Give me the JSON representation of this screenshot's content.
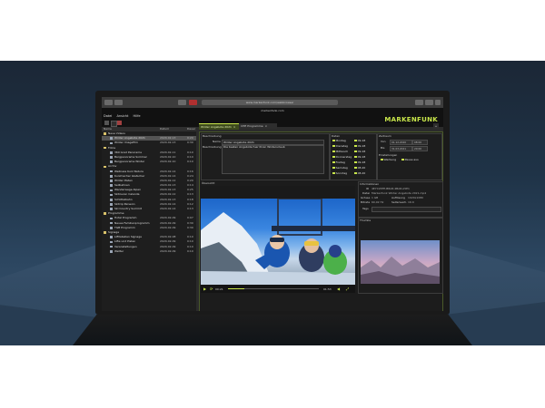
{
  "browser": {
    "url": "www.markenfunk.com/webbrowser",
    "app_title": "markenfunk.com"
  },
  "header": {
    "logo": "MARKENFUNK",
    "menu": [
      "Datei",
      "Ansicht",
      "Hilfe"
    ]
  },
  "tabs": [
    {
      "label": "Winter Angebote 2021",
      "active": true
    },
    {
      "label": "CHE Programme",
      "active": false
    }
  ],
  "sidebar": {
    "columns": [
      "Name",
      "Datum",
      "Dauer"
    ],
    "items": [
      {
        "name": "Neue Videos",
        "date": "",
        "time": "",
        "level": 0,
        "type": "folder",
        "selected": false
      },
      {
        "name": "Winter Angebote 2021",
        "date": "2020-02-13",
        "time": "0:20",
        "level": 1,
        "type": "video",
        "selected": true
      },
      {
        "name": "Winter Imagefilm",
        "date": "2020-02-13",
        "time": "0:30",
        "level": 1,
        "type": "video",
        "selected": false
      },
      {
        "name": "Fotos",
        "date": "",
        "time": "",
        "level": 0,
        "type": "folder",
        "selected": false
      },
      {
        "name": "360 Grad Panorama",
        "date": "2020-02-11",
        "time": "0:10",
        "level": 1,
        "type": "video",
        "selected": false
      },
      {
        "name": "Bergpanorama Sommer",
        "date": "2020-02-10",
        "time": "0:10",
        "level": 1,
        "type": "video",
        "selected": false
      },
      {
        "name": "Bergpanorama Winter",
        "date": "2020-02-10",
        "time": "0:10",
        "level": 1,
        "type": "video",
        "selected": false
      },
      {
        "name": "Archiv",
        "date": "",
        "time": "",
        "level": 0,
        "type": "folder",
        "selected": false
      },
      {
        "name": "Wellness Kurz Natura",
        "date": "2020-02-14",
        "time": "0:16",
        "level": 1,
        "type": "video",
        "selected": false
      },
      {
        "name": "Kurzmacher Gletscher",
        "date": "2020-02-14",
        "time": "0:24",
        "level": 1,
        "type": "video",
        "selected": false
      },
      {
        "name": "Winter Pisten",
        "date": "2020-02-12",
        "time": "0:20",
        "level": 1,
        "type": "video",
        "selected": false
      },
      {
        "name": "Seilbahnen",
        "date": "2020-02-13",
        "time": "0:14",
        "level": 1,
        "type": "video",
        "selected": false
      },
      {
        "name": "Wanderwege Alpen",
        "date": "2020-02-13",
        "time": "0:25",
        "level": 1,
        "type": "video",
        "selected": false
      },
      {
        "name": "Skitouren Calanda",
        "date": "2020-02-12",
        "time": "0:13",
        "level": 1,
        "type": "video",
        "selected": false
      },
      {
        "name": "Schlittelbahn",
        "date": "2020-02-13",
        "time": "0:18",
        "level": 1,
        "type": "video",
        "selected": false
      },
      {
        "name": "Skitrip Parsenn",
        "date": "2020-02-14",
        "time": "0:12",
        "level": 1,
        "type": "video",
        "selected": false
      },
      {
        "name": "Ski Country Summit",
        "date": "2020-02-14",
        "time": "0:13",
        "level": 1,
        "type": "video",
        "selected": false
      },
      {
        "name": "Programme",
        "date": "",
        "time": "",
        "level": 0,
        "type": "folder",
        "selected": false
      },
      {
        "name": "Hotel Programm",
        "date": "2020-02-09",
        "time": "0:07",
        "level": 1,
        "type": "video",
        "selected": false
      },
      {
        "name": "Neues Familienprogramm",
        "date": "2020-02-09",
        "time": "0:30",
        "level": 1,
        "type": "video",
        "selected": false
      },
      {
        "name": "TGB Programm",
        "date": "2020-02-09",
        "time": "0:30",
        "level": 1,
        "type": "video",
        "selected": false
      },
      {
        "name": "Signage",
        "date": "",
        "time": "",
        "level": 0,
        "type": "folder",
        "selected": false
      },
      {
        "name": "Lifttabellen Signage",
        "date": "2020-02-08",
        "time": "0:10",
        "level": 1,
        "type": "video",
        "selected": false
      },
      {
        "name": "Lifte und Pisten",
        "date": "2020-02-09",
        "time": "0:10",
        "level": 1,
        "type": "video",
        "selected": false
      },
      {
        "name": "Veranstaltungen",
        "date": "2020-02-09",
        "time": "0:10",
        "level": 1,
        "type": "video",
        "selected": false
      },
      {
        "name": "Wetter",
        "date": "2020-02-09",
        "time": "0:10",
        "level": 1,
        "type": "video",
        "selected": false
      }
    ]
  },
  "description": {
    "section": "Beschreibung",
    "name_label": "Name",
    "name_value": "Winter Angebote 2021",
    "desc_label": "Beschreibung",
    "desc_value": "Die besten Angebote fuer Ihren Winterurlaub"
  },
  "days": {
    "section": "Daten",
    "items": [
      {
        "label": "Montag",
        "time": "09-18"
      },
      {
        "label": "Dienstag",
        "time": "09-18"
      },
      {
        "label": "Mittwoch",
        "time": "09-18"
      },
      {
        "label": "Donnerstag",
        "time": "09-18"
      },
      {
        "label": "Freitag",
        "time": "09-18"
      },
      {
        "label": "Samstag",
        "time": "08-20"
      },
      {
        "label": "Sonntag",
        "time": "08-20"
      }
    ]
  },
  "schedule": {
    "section": "Zeitraum",
    "from_label": "Von",
    "to_label": "Bis",
    "from_date": "01.12.2020",
    "from_time": "08:00",
    "to_date": "31.03.2021",
    "to_time": "20:00",
    "options_label": "Einstellungen",
    "option1": "Werbung",
    "option2": "Pause aus"
  },
  "preview": {
    "section": "Übersicht",
    "time_current": "00:21",
    "time_total": "01:53",
    "progress": 0.18
  },
  "information": {
    "section": "Informationen",
    "id_label": "ID",
    "id_value": "4E7C95FE-B8A8-4BA8-A5E1",
    "file_label": "Datei",
    "file_value": "Markenfunk Winter Angebote 2021.mp4",
    "size_label": "Grösse",
    "size_value": "1 GB",
    "res_label": "Auflösung",
    "res_value": "1920x1080",
    "ratio_label": "Bitrate",
    "ratio_value": "60,02 Hz",
    "fps_label": "Seitenverh.",
    "fps_value": "16:9",
    "tags_label": "Tags",
    "thumb_section": "Thumbs"
  },
  "colors": {
    "accent": "#c8e64a",
    "background": "#1c1c1c"
  }
}
